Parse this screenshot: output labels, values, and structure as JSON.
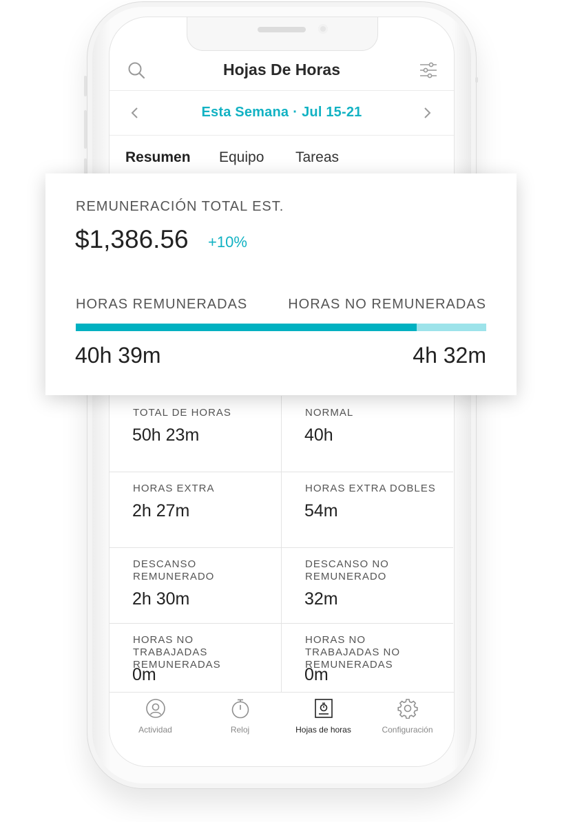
{
  "header": {
    "title": "Hojas De Horas",
    "search_icon": "search-icon",
    "filter_icon": "filter-sliders-icon"
  },
  "date_nav": {
    "period": "Esta Semana",
    "separator": "·",
    "range": "Jul 15-21"
  },
  "tabs": [
    {
      "label": "Resumen",
      "active": true
    },
    {
      "label": "Equipo",
      "active": false
    },
    {
      "label": "Tareas",
      "active": false
    }
  ],
  "summary": {
    "total_pay_label": "REMUNERACIÓN TOTAL EST.",
    "total_pay_value": "$1,386.56",
    "change": "+10%",
    "paid_label": "HORAS REMUNERADAS",
    "unpaid_label": "HORAS NO REMUNERADAS",
    "paid_value": "40h 39m",
    "unpaid_value": "4h 32m",
    "paid_fraction": 0.83,
    "colors": {
      "accent": "#00b1c1",
      "accent_light": "#9de3ea"
    }
  },
  "stats": [
    {
      "label": "TOTAL DE HORAS",
      "value": "50h 23m"
    },
    {
      "label": "NORMAL",
      "value": "40h"
    },
    {
      "label": "HORAS EXTRA",
      "value": "2h 27m"
    },
    {
      "label": "HORAS EXTRA DOBLES",
      "value": "54m"
    },
    {
      "label": "DESCANSO REMUNERADO",
      "value": "2h 30m"
    },
    {
      "label": "DESCANSO NO REMUNERADO",
      "value": "32m"
    },
    {
      "label": "HORAS NO TRABAJADAS REMUNERADAS",
      "value": "0m"
    },
    {
      "label": "HORAS NO TRABAJADAS NO REMUNERADAS",
      "value": "0m"
    }
  ],
  "nav": [
    {
      "label": "Actividad",
      "icon": "user-circle-icon",
      "active": false
    },
    {
      "label": "Reloj",
      "icon": "stopwatch-icon",
      "active": false
    },
    {
      "label": "Hojas de horas",
      "icon": "timesheet-icon",
      "active": true
    },
    {
      "label": "Configuración",
      "icon": "gear-icon",
      "active": false
    }
  ]
}
